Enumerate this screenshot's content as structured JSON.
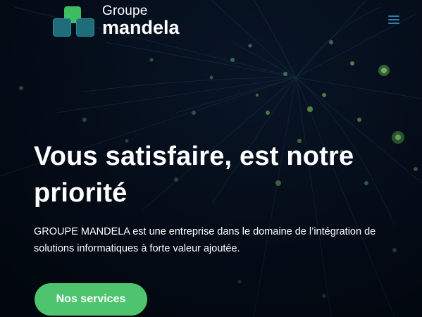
{
  "header": {
    "logo": {
      "line1": "Groupe",
      "line2": "mandela"
    },
    "menu_icon": "hamburger-menu-icon"
  },
  "hero": {
    "title": "Vous satisfaire, est notre priorité",
    "description": "GROUPE MANDELA est une entreprise dans le domaine de l’intégration de solutions informatiques à forte valeur ajoutée.",
    "cta_label": "Nos services"
  },
  "colors": {
    "accent_green": "#4fc46e",
    "logo_green": "#3fbd62",
    "logo_teal": "#1f6d7b",
    "menu_blue": "#2e7fb0",
    "background": "#030914"
  }
}
